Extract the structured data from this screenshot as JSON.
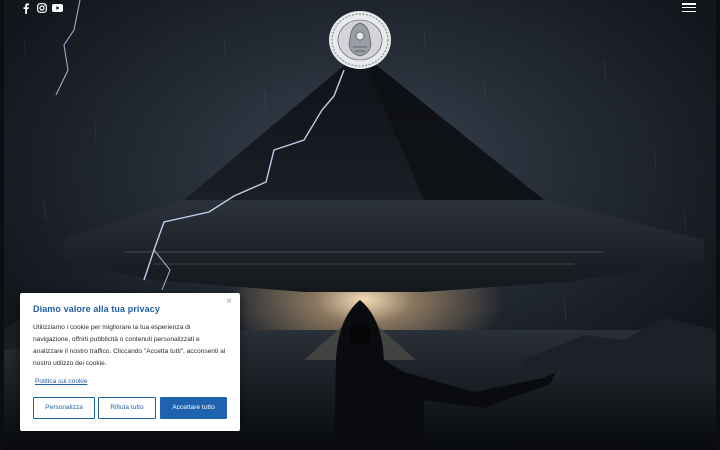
{
  "header": {
    "social_icons": [
      "facebook-icon",
      "instagram-icon",
      "youtube-icon"
    ],
    "menu_icon": "hamburger-menu-icon"
  },
  "logo": {
    "icon": "ancient-seal-logo"
  },
  "cookie_banner": {
    "title": "Diamo valore alla tua privacy",
    "text": "Utilizziamo i cookie per migliorare la tua esperienza di navigazione, offrirti pubblicità o contenuti personalizzati e analizzare il nostro traffico. Cliccando \"Accetta tutti\", acconsenti al nostro utilizzo dei cookie.",
    "policy_link": "Politica sui cookie",
    "close_glyph": "×",
    "buttons": {
      "customize": "Personalizza",
      "reject": "Rifiuta tutto",
      "accept": "Accettare tutto"
    }
  },
  "colors": {
    "accent": "#1f5fa8",
    "accent_button": "#1f63b0",
    "page_bg": "#0b0d12"
  }
}
